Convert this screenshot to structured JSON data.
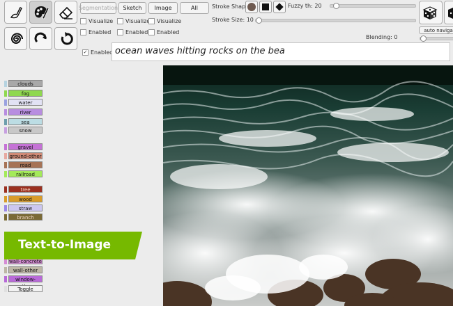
{
  "toolbar": {
    "tools_row1": [
      {
        "name": "brush-tool",
        "icon": "paint-brush-icon"
      },
      {
        "name": "palette-tool",
        "icon": "paint-palette-icon",
        "selected": true
      },
      {
        "name": "eraser-tool",
        "icon": "eraser-icon"
      }
    ],
    "tools_row2": [
      {
        "name": "spiral-tool",
        "icon": "spiral-icon"
      },
      {
        "name": "redo-tool",
        "icon": "redo-arrow-icon"
      },
      {
        "name": "refresh-tool",
        "icon": "refresh-arrow-icon"
      }
    ],
    "buttons": {
      "segmentation": "Segmentation",
      "sketch": "Sketch",
      "image": "Image",
      "all": "All"
    },
    "checks": {
      "visualize": "Visualize",
      "enabled": "Enabled"
    },
    "stroke_shape_label": "Stroke Shape",
    "stroke_size_label": "Stroke Size: 10",
    "stroke_size_value": 10,
    "fuzzy_label": "Fuzzy th: 20",
    "fuzzy_value": 20,
    "blending_label": "Blending: 0",
    "blending_value": 0,
    "auto_nav_label": "auto naviga",
    "shape_color": "#6e5a50"
  },
  "prompt": {
    "enabled_label": "Enabled",
    "enabled_checked": true,
    "text": "ocean waves hitting rocks on the bea"
  },
  "labels": [
    {
      "text": "clouds",
      "color": "#a8a8a8",
      "edge": "#b6d3e0"
    },
    {
      "text": "fog",
      "color": "#8fd84f",
      "edge": "#8fd84f"
    },
    {
      "text": "water",
      "color": "#e2e2f4",
      "edge": "#9aa2e0"
    },
    {
      "text": "river",
      "color": "#b88de0",
      "edge": "#b88de0"
    },
    {
      "text": "sea",
      "color": "#bcdde4",
      "edge": "#6e9fad"
    },
    {
      "text": "snow",
      "color": "#c8c8c8",
      "edge": "#c7a0e0"
    },
    {
      "text": "gravel",
      "color": "#c572d6",
      "edge": "#c572d6"
    },
    {
      "text": "ground-other",
      "color": "#d08a76",
      "edge": "#e7a9a0"
    },
    {
      "text": "road",
      "color": "#a67356",
      "edge": "#a67356"
    },
    {
      "text": "railroad",
      "color": "#a4ea5a",
      "edge": "#a4ea5a"
    },
    {
      "text": "tree",
      "color": "#9b301f",
      "edge": "#9b301f"
    },
    {
      "text": "wood",
      "color": "#d89b2a",
      "edge": "#d89b2a"
    },
    {
      "text": "straw",
      "color": "#ccc7f0",
      "edge": "#9b87e8"
    },
    {
      "text": "branch",
      "color": "#7a6a35",
      "edge": "#7a6a35"
    },
    {
      "text": "wall-concrete",
      "color": "#d48bd4",
      "edge": "#d48bd4"
    },
    {
      "text": "wall-other",
      "color": "#bdb7a6",
      "edge": "#bdb7a6"
    },
    {
      "text": "window-other",
      "color": "#b86ad8",
      "edge": "#b86ad8"
    },
    {
      "text": "Toggle",
      "color": "#f2f2f2",
      "edge": "#e0e0e0"
    }
  ],
  "banner": {
    "text": "Text-to-Image",
    "color": "#76b900"
  }
}
